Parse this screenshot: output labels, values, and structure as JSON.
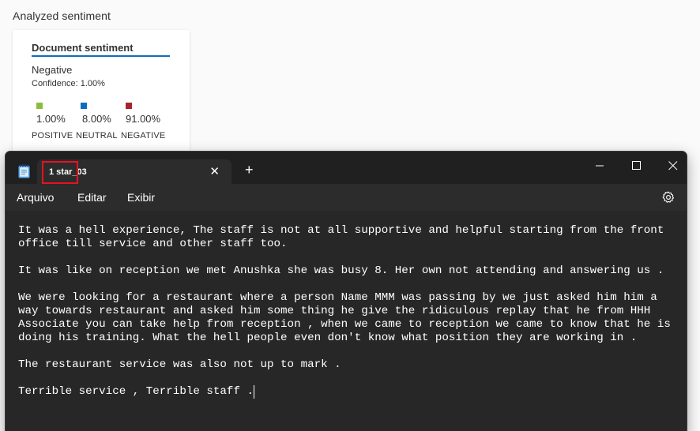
{
  "sentiment": {
    "heading": "Analyzed sentiment",
    "card_title": "Document sentiment",
    "document_label": "Negative",
    "confidence": "Confidence: 1.00%",
    "positive": {
      "value": "1.00%",
      "label": "POSITIVE",
      "color": "#8cbd3a"
    },
    "neutral": {
      "value": "8.00%",
      "label": "NEUTRAL",
      "color": "#0f6cbd"
    },
    "negative": {
      "value": "91.00%",
      "label": "NEGATIVE",
      "color": "#a4262c"
    }
  },
  "notepad": {
    "tab_title": "1 star_03",
    "icons": {
      "app": "notepad-icon",
      "close_tab": "close-icon",
      "new_tab": "plus-icon",
      "minimize": "minimize-icon",
      "maximize": "maximize-icon",
      "close_window": "close-icon",
      "settings": "gear-icon"
    },
    "menu": {
      "file": "Arquivo",
      "edit": "Editar",
      "view": "Exibir"
    },
    "text_lines": [
      "It was a hell experience, The staff is not at all supportive and helpful starting from the front office till service and other staff too.",
      "",
      "It was like on reception we met Anushka she was busy 8. Her own not attending and answering us .",
      "",
      "We were looking for a restaurant where a person Name MMM was passing by we just asked him him a way towards restaurant and asked him some thing he give the ridiculous replay that he from HHH Associate you can take help from reception , when we came to reception we came to know that he is doing his training. What the hell people even don't know what position they are working in .",
      "",
      "The restaurant service was also not up to mark .",
      "",
      "Terrible service , Terrible staff ."
    ]
  }
}
